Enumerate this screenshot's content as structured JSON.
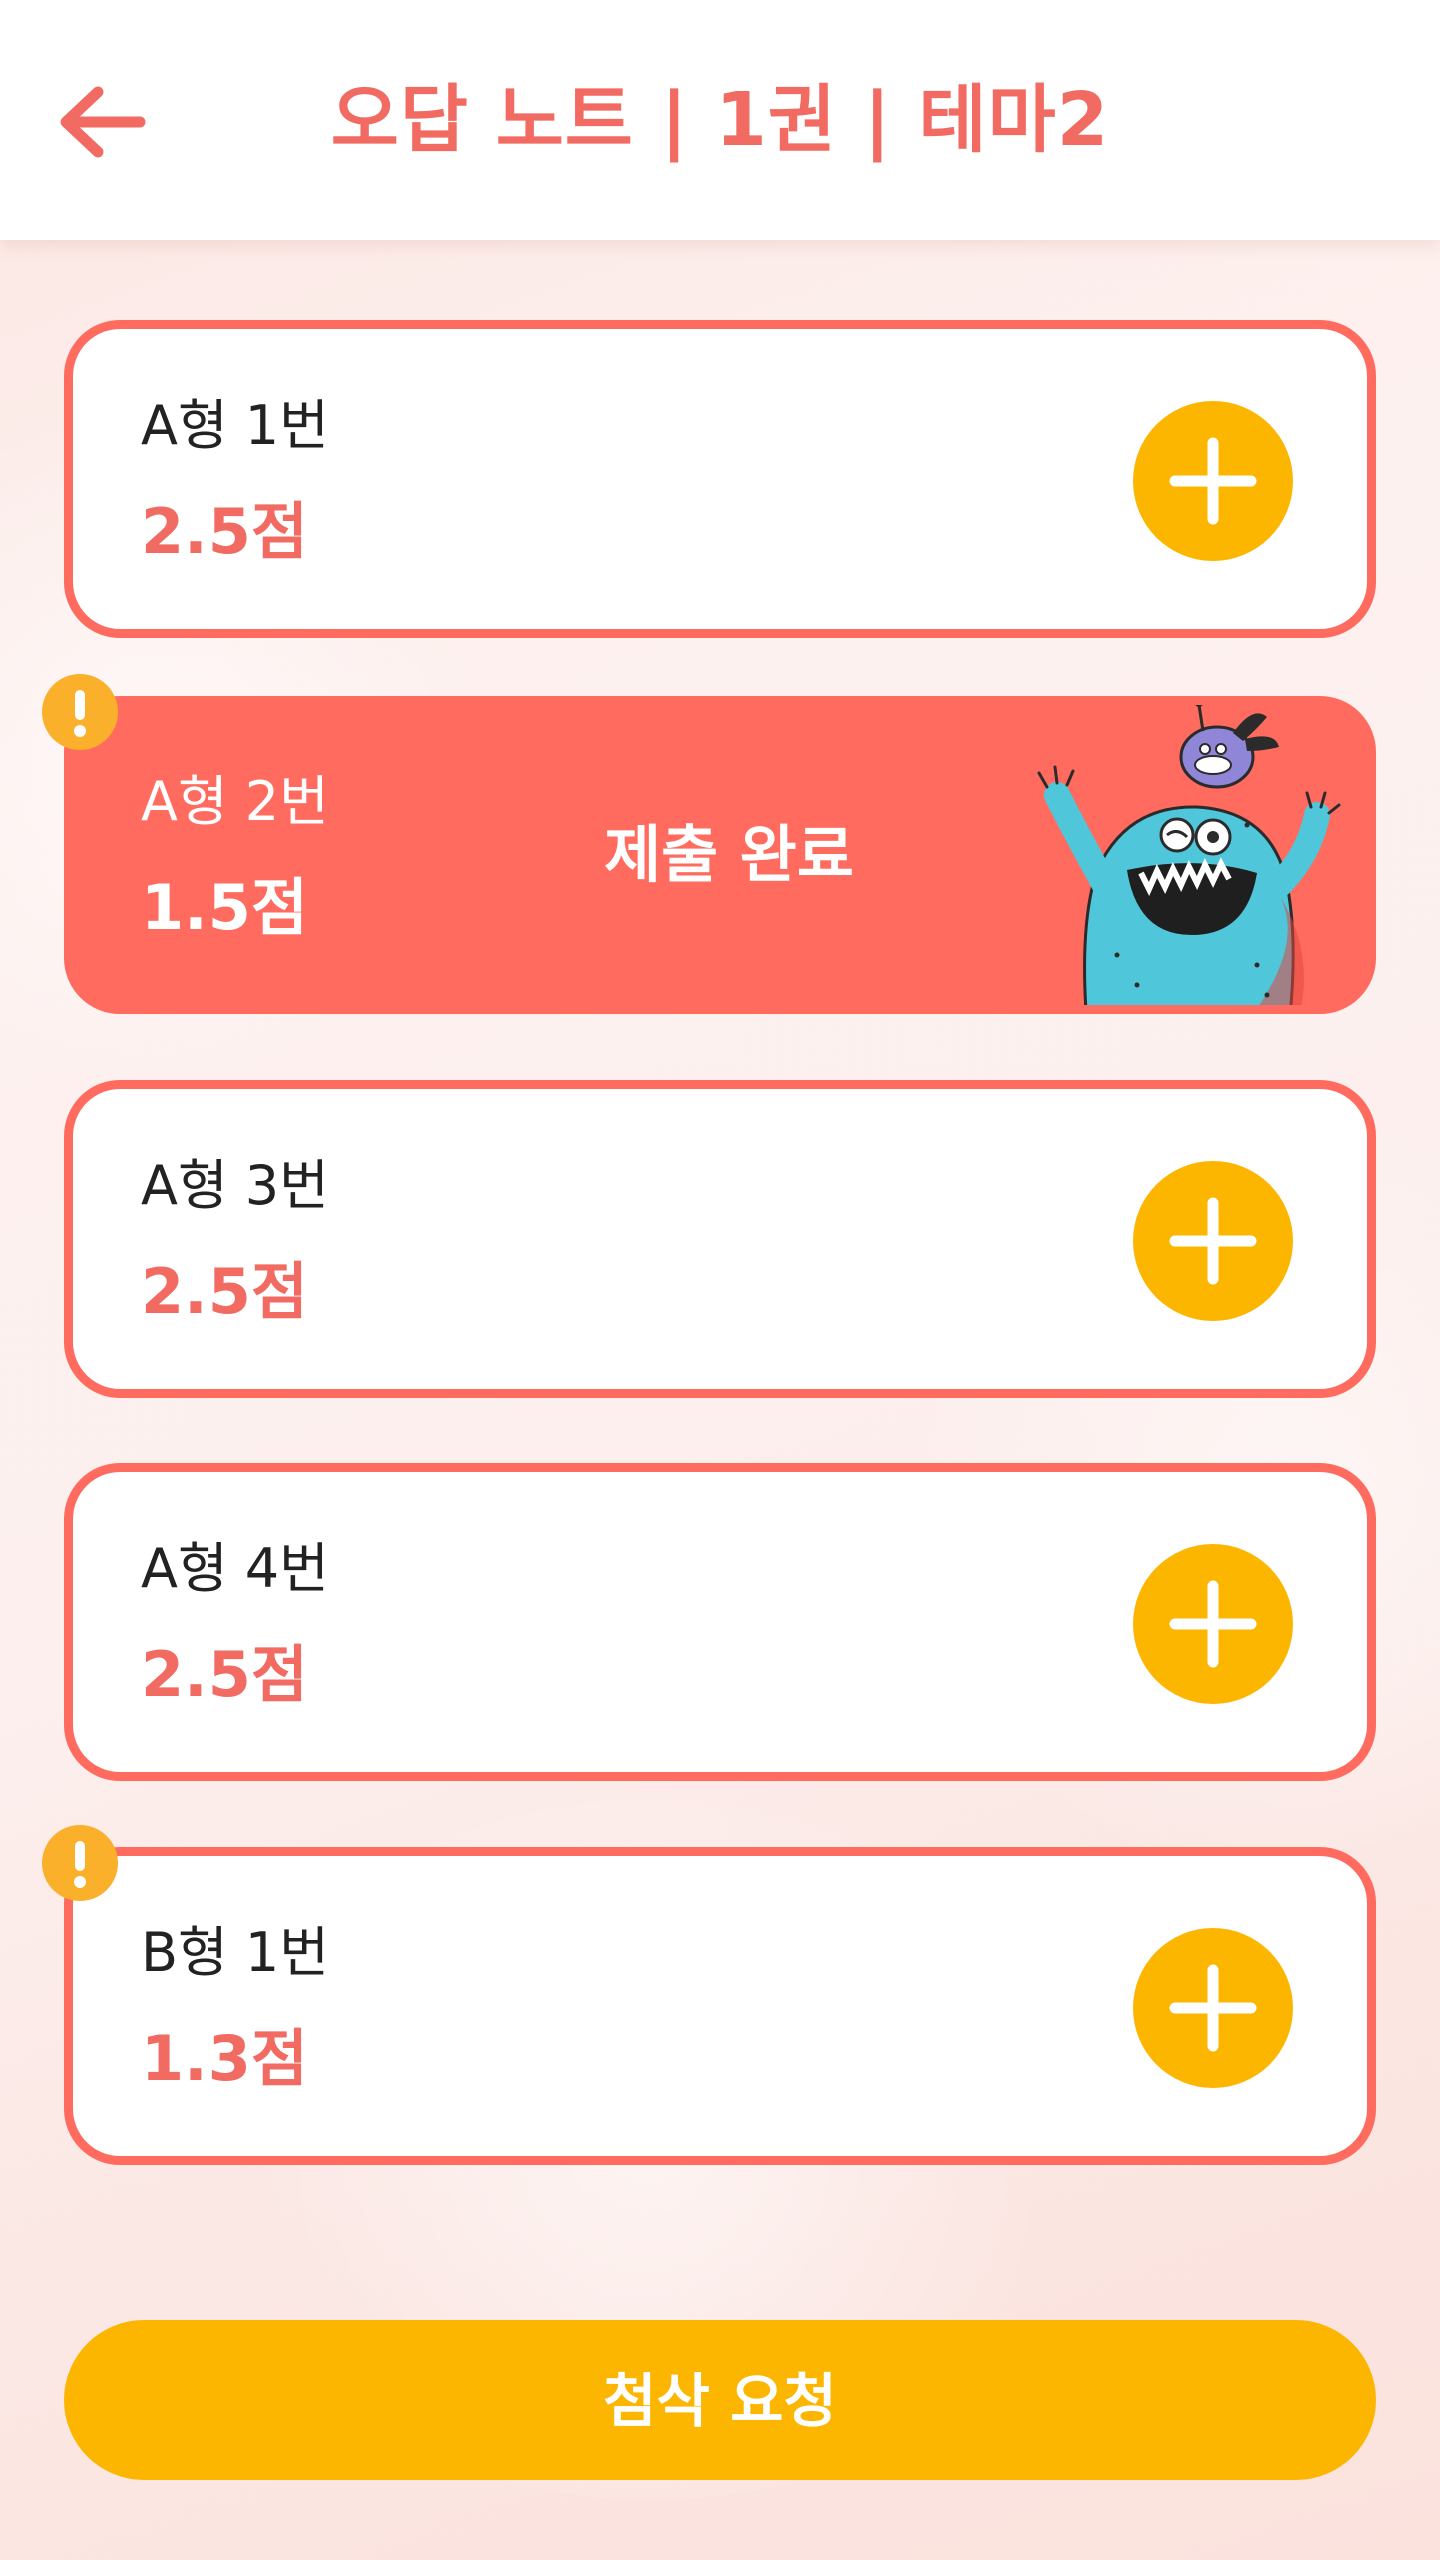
{
  "header": {
    "title": "오답 노트 | 1권 | 테마2",
    "back_icon": "back-arrow-icon"
  },
  "items": [
    {
      "type": "A형 1번",
      "score": "2.5점",
      "status": "pending",
      "warning": false
    },
    {
      "type": "A형 2번",
      "score": "1.5점",
      "status": "submitted",
      "status_label": "제출 완료",
      "warning": true
    },
    {
      "type": "A형 3번",
      "score": "2.5점",
      "status": "pending",
      "warning": false
    },
    {
      "type": "A형 4번",
      "score": "2.5점",
      "status": "pending",
      "warning": false
    },
    {
      "type": "B형 1번",
      "score": "1.3점",
      "status": "pending",
      "warning": true
    }
  ],
  "submit": {
    "label": "첨삭 요청"
  },
  "colors": {
    "accent": "#f26b63",
    "card_border": "#ff6b5e",
    "button": "#fdb600",
    "warning": "#fbb02b"
  }
}
